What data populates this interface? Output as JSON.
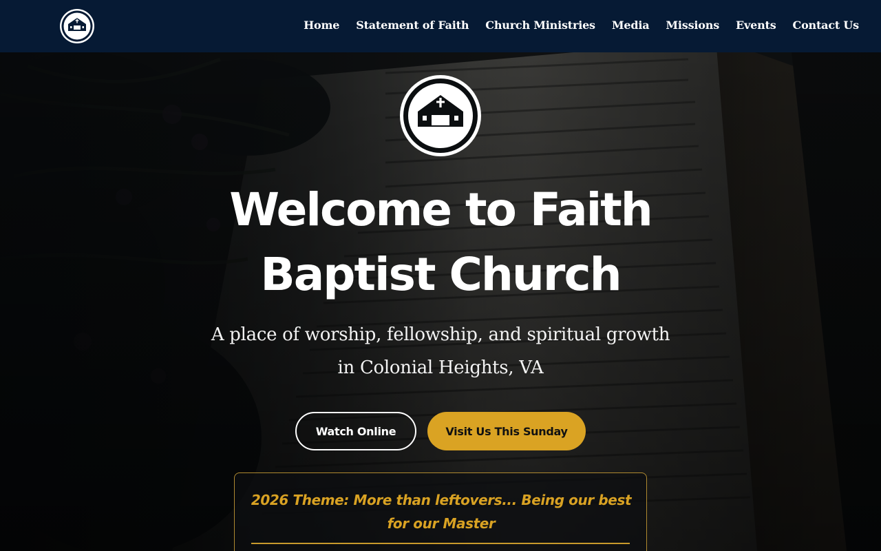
{
  "colors": {
    "header_bg": "#061a34",
    "accent_gold": "#daa323",
    "text_white": "#ffffff"
  },
  "header": {
    "logo_icon": "church-building-icon",
    "nav": [
      {
        "label": "Home"
      },
      {
        "label": "Statement of Faith"
      },
      {
        "label": "Church Ministries"
      },
      {
        "label": "Media"
      },
      {
        "label": "Missions"
      },
      {
        "label": "Events"
      },
      {
        "label": "Contact Us"
      }
    ]
  },
  "hero": {
    "logo_icon": "church-building-icon",
    "title_line1": "Welcome to Faith",
    "title_line2": "Baptist Church",
    "subtitle_line1": "A place of worship, fellowship, and spiritual growth",
    "subtitle_line2": "in Colonial Heights, VA",
    "buttons": {
      "watch": "Watch Online",
      "visit": "Visit Us This Sunday"
    },
    "theme": {
      "line1": "2026 Theme: More than leftovers... Being our best",
      "line2": "for our Master"
    }
  }
}
